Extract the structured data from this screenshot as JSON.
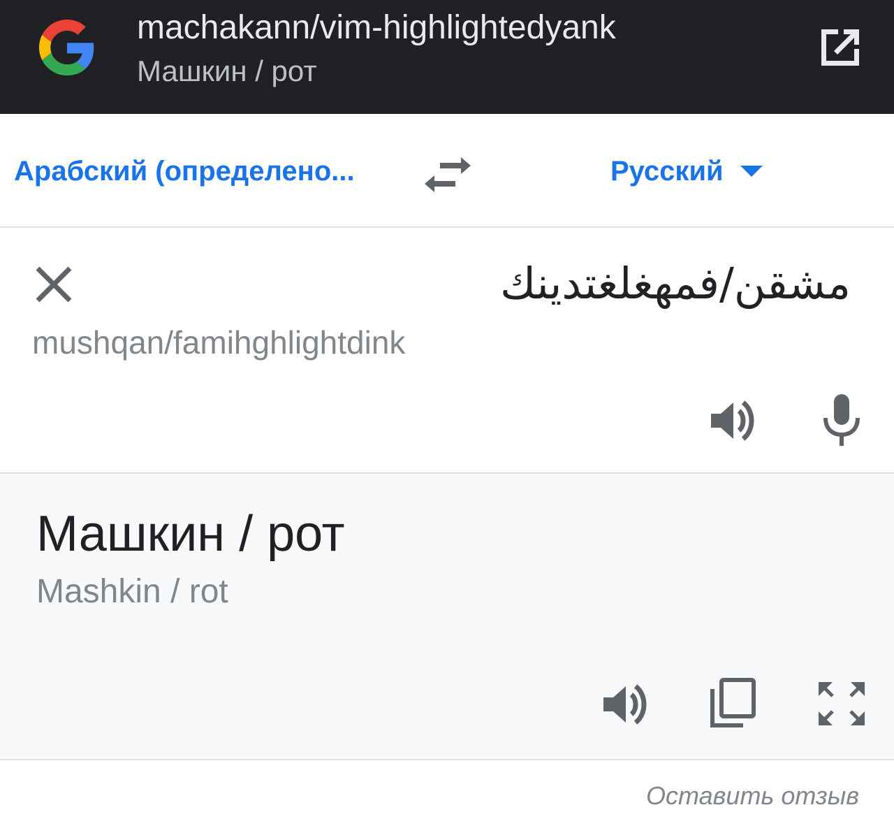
{
  "header": {
    "title": "machakann/vim-highlightedyank",
    "subtitle": "Машкин / рот",
    "logo_icon": "google-g-logo",
    "open_external_icon": "open-in-new-icon"
  },
  "languages": {
    "source_label": "Арабский (определено...",
    "target_label": "Русский",
    "swap_icon": "swap-horiz-icon",
    "caret_icon": "arrow-drop-down-icon"
  },
  "source": {
    "text": "مشقن/فمهغلغتدينك",
    "transliteration": "mushqan/famihghlightdink",
    "icons": [
      "close-icon",
      "volume-up-icon",
      "mic-icon"
    ]
  },
  "result": {
    "text": "Машкин / рот",
    "transliteration": "Mashkin / rot",
    "icons": [
      "volume-up-icon",
      "copy-icon",
      "fullscreen-icon"
    ]
  },
  "footer": {
    "feedback_label": "Оставить отзыв"
  },
  "colors": {
    "topbar_bg": "#202124",
    "accent_blue": "#1a73e8",
    "secondary_text": "#80868b",
    "icon_gray": "#5f6368",
    "result_bg": "#f8f9fa"
  }
}
